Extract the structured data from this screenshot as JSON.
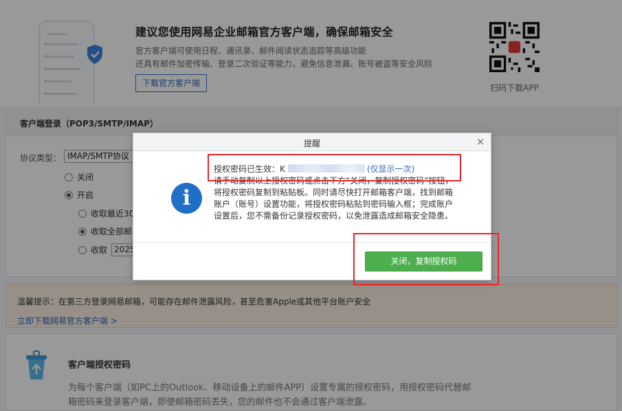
{
  "promo": {
    "title": "建议您使用网易企业邮箱官方客户端，确保邮箱安全",
    "line1": "官方客户端可使用日程、通讯录、邮件阅读状态追踪等高级功能",
    "line2": "还具有邮件加密传输、登录二次验证等能力，避免信息泄漏、账号被盗等安全风险",
    "download_button": "下载官方客户端",
    "qr_caption": "扫码下载APP"
  },
  "client_login": {
    "title": "客户端登录（POP3/SMTP/IMAP）",
    "protocol_label": "协议类型：",
    "protocol_value": "IMAP/SMTP协议",
    "off_label": "关闭",
    "on_label": "开启",
    "recent_label": "收取最近30",
    "all_label": "收取全部邮",
    "from_label": "收取",
    "from_date": "2025"
  },
  "warning": {
    "text": "温馨提示：在第三方登录网易邮箱，可能存在邮件泄露风险，甚至危害Apple或其他平台账户安全",
    "link": "立即下载网易官方客户端 >"
  },
  "auth_code": {
    "title": "客户端授权密码",
    "description": "为每个客户端（如PC上的Outlook、移动设备上的邮件APP）设置专属的授权密码，用授权密码代替邮箱密码来登录客户端，即使邮箱密码丢失，您的邮件也不会通过客户端泄露。"
  },
  "dialog": {
    "title": "提醒",
    "close": "×",
    "code_prefix": "授权密码已生效：K",
    "code_note": "(仅显示一次)",
    "message": "请手动复制以上授权密码或点击下方“关闭，复制授权密码”按钮，将授权密码复制到粘贴板。同时请尽快打开邮箱客户端，找到邮箱账户（账号）设置功能，将授权密码粘贴到密码输入框；完成账户设置后，您不需备份记录授权密码，以免泄露造成邮箱安全隐患。",
    "confirm_button": "关闭，复制授权码"
  },
  "colors": {
    "primary_blue": "#2f66bd",
    "confirm_green": "#4cae4c",
    "highlight_red": "#e8222b",
    "warning_bg": "#fbf1e4"
  }
}
